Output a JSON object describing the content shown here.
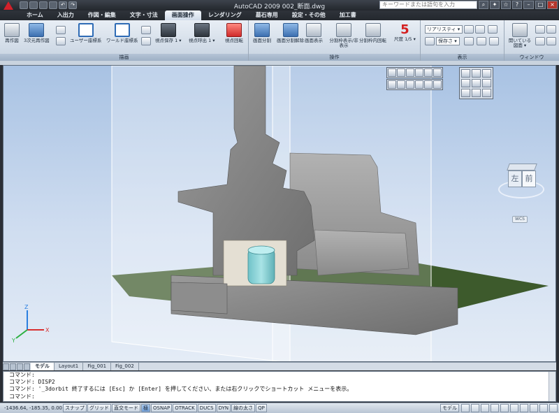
{
  "window": {
    "title": "AutoCAD 2009 002_断面.dwg",
    "search_placeholder": "キーワードまたは語句を入力"
  },
  "tabs": [
    "ホーム",
    "入出力",
    "作図・編集",
    "文字・寸法",
    "画面操作",
    "レンダリング",
    "墓石専用",
    "設定・その他",
    "加工書"
  ],
  "active_tab": "画面操作",
  "ribbon": {
    "panels": [
      {
        "title": "描画",
        "buttons": [
          "再作図",
          "3次元再作図",
          "ユーザー座標系",
          "ワールド座標系",
          "視点保存 1 ▾",
          "視点呼出 1 ▾",
          "視点回転"
        ]
      },
      {
        "title": "操作",
        "buttons": [
          "画面分割",
          "画面分割解除",
          "画面表示",
          "分割枠表示/非表示",
          "分割枠内回転",
          "尺度 1/5 ▾"
        ]
      },
      {
        "title": "表示",
        "buttons": [
          "リアリスティ ▾",
          "保存さ ▾"
        ]
      },
      {
        "title": "ウィンドウ",
        "buttons": [
          "開いている図面 ▾"
        ]
      }
    ],
    "scale_number": "5"
  },
  "viewport": {
    "viewcube": {
      "left": "左",
      "front": "前"
    },
    "wcs_label": "WCS",
    "axes": {
      "x": "X",
      "y": "Y",
      "z": "Z"
    }
  },
  "layout_tabs": [
    "モデル",
    "Layout1",
    "Fig_001",
    "Fig_002"
  ],
  "active_layout_tab": "モデル",
  "command_lines": [
    "コマンド:",
    "コマンド: DISP2",
    "コマンド: '_3dorbit 終了するには [Esc] か [Enter] を押してください、または右クリックでショートカット メニューを表示。"
  ],
  "command_prompt": "コマンド:",
  "status": {
    "coords": "-1436.64, -185.35, 0.00",
    "toggles": [
      "スナップ",
      "グリッド",
      "直交モード",
      "極",
      "OSNAP",
      "OTRACK",
      "DUCS",
      "DYN",
      "線の太さ",
      "QP"
    ],
    "active_toggle": "極",
    "model_label": "モデル"
  }
}
